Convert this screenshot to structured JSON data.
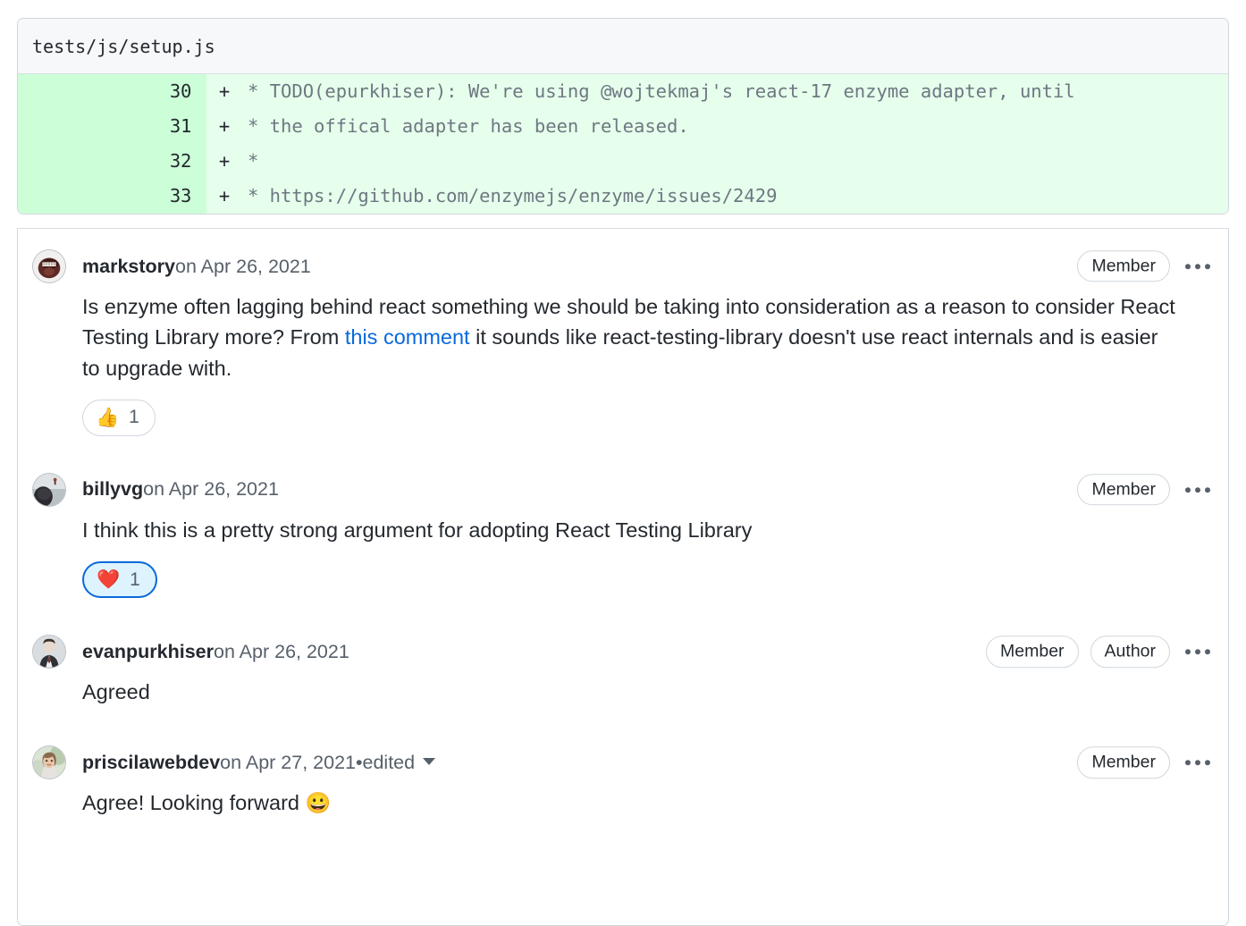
{
  "diff": {
    "filename": "tests/js/setup.js",
    "lines": [
      {
        "number": "30",
        "marker": "+",
        "code": "* TODO(epurkhiser): We're using @wojtekmaj's react-17 enzyme adapter, until"
      },
      {
        "number": "31",
        "marker": "+",
        "code": "* the offical adapter has been released."
      },
      {
        "number": "32",
        "marker": "+",
        "code": "*"
      },
      {
        "number": "33",
        "marker": "+",
        "code": "* https://github.com/enzymejs/enzyme/issues/2429"
      }
    ],
    "colors": {
      "gutter": "#ccffd8",
      "code_bg": "#e6ffec",
      "header_bg": "#f6f8fa",
      "border": "#d0d7de"
    }
  },
  "comments": [
    {
      "author": "markstory",
      "timestamp": " on Apr 26, 2021",
      "badges": [
        "Member"
      ],
      "body_parts": [
        {
          "type": "text",
          "text": "Is enzyme often lagging behind react something we should be taking into consideration as a reason to consider React Testing Library more? From "
        },
        {
          "type": "link",
          "text": "this comment"
        },
        {
          "type": "text",
          "text": " it sounds like react-testing-library doesn't use react internals and is easier to upgrade with."
        }
      ],
      "reaction": {
        "emoji": "👍",
        "count": "1",
        "active": false
      },
      "menu": "more-options"
    },
    {
      "author": "billyvg",
      "timestamp": " on Apr 26, 2021",
      "badges": [
        "Member"
      ],
      "body_parts": [
        {
          "type": "text",
          "text": "I think this is a pretty strong argument for adopting React Testing Library"
        }
      ],
      "reaction": {
        "emoji": "❤️",
        "count": "1",
        "active": true
      },
      "menu": "more-options"
    },
    {
      "author": "evanpurkhiser",
      "timestamp": " on Apr 26, 2021",
      "badges": [
        "Member",
        "Author"
      ],
      "body_parts": [
        {
          "type": "text",
          "text": "Agreed"
        }
      ],
      "reaction": null,
      "menu": "more-options"
    },
    {
      "author": "priscilawebdev",
      "timestamp": " on Apr 27, 2021",
      "edited_separator": " • ",
      "edited_label": "edited",
      "badges": [
        "Member"
      ],
      "body_parts": [
        {
          "type": "text",
          "text": "Agree! Looking forward "
        },
        {
          "type": "emoji",
          "text": "😀"
        }
      ],
      "reaction": null,
      "menu": "more-options"
    }
  ],
  "theme": {
    "link_color": "#0969da",
    "text_color": "#24292f",
    "muted_color": "#57606a",
    "reaction_active_bg": "#ddf4ff",
    "reaction_active_border": "#0969da"
  }
}
